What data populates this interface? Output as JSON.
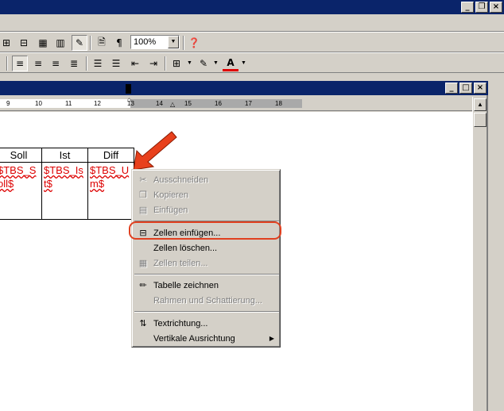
{
  "window": {
    "min_btn": "_",
    "max_btn": "❐",
    "close_btn": "×"
  },
  "doc_window": {
    "min_btn": "_",
    "max_btn": "□",
    "close_btn": "×"
  },
  "toolbar1": {
    "zoom_value": "100%",
    "show_marks_glyph": "¶"
  },
  "ruler": {
    "numbers": [
      "9",
      "10",
      "11",
      "12",
      "13",
      "14",
      "15",
      "16",
      "17",
      "18"
    ]
  },
  "table": {
    "headers": [
      "Soll",
      "Ist",
      "Diff"
    ],
    "cells": [
      "$TBS_Soll$",
      "$TBS_Ist$",
      "$TBS_Um$"
    ]
  },
  "context_menu": {
    "items": [
      {
        "label": "Ausschneiden",
        "icon": "scissors-icon",
        "disabled": true
      },
      {
        "label": "Kopieren",
        "icon": "copy-icon",
        "disabled": true
      },
      {
        "label": "Einfügen",
        "icon": "paste-icon",
        "disabled": true
      },
      {
        "label": "Zellen einfügen...",
        "icon": "insert-cells-icon",
        "disabled": false
      },
      {
        "label": "Zellen löschen...",
        "icon": "",
        "disabled": false
      },
      {
        "label": "Zellen teilen...",
        "icon": "split-cells-icon",
        "disabled": true
      },
      {
        "label": "Tabelle zeichnen",
        "icon": "pencil-icon",
        "disabled": false
      },
      {
        "label": "Rahmen und Schattierung...",
        "icon": "",
        "disabled": true
      },
      {
        "label": "Textrichtung...",
        "icon": "text-direction-icon",
        "disabled": false
      },
      {
        "label": "Vertikale Ausrichtung",
        "icon": "",
        "disabled": false,
        "submenu": true
      }
    ]
  },
  "colors": {
    "title_bar": "#0a246a",
    "highlight": "#e04020",
    "arrow": "#e8401c",
    "error_text": "#d00000"
  }
}
